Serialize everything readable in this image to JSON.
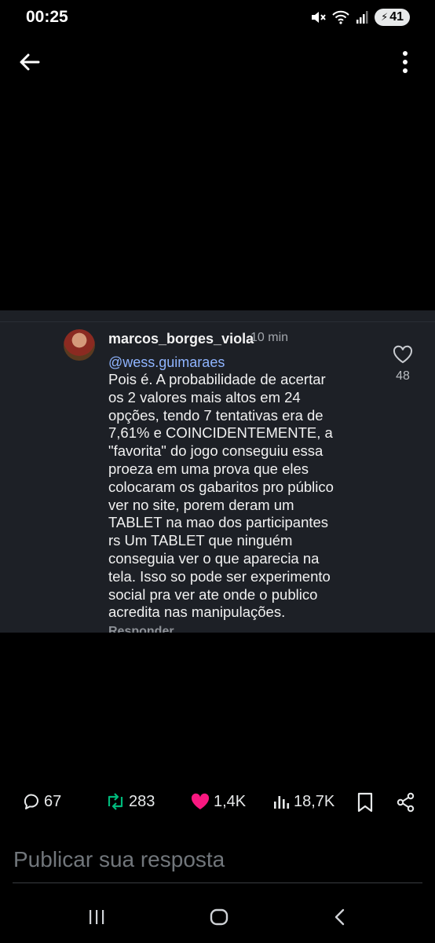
{
  "status_bar": {
    "time": "00:25",
    "battery": "41"
  },
  "comment": {
    "username": "marcos_borges_viola",
    "time_ago": "10 min",
    "mention": "@wess.guimaraes",
    "lines": [
      "Pois é. A probabilidade de acertar",
      "os 2 valores mais altos em 24",
      "opções, tendo 7 tentativas era de",
      "7,61% e COINCIDENTEMENTE, a",
      "\"favorita\" do jogo conseguiu essa",
      "proeza em uma prova que eles",
      "colocaram os gabaritos pro público",
      "ver no site, porem deram um",
      "TABLET na mao dos participantes",
      "rs Um TABLET que ninguém",
      "conseguia ver o que aparecia na",
      "tela. Isso so pode ser experimento",
      "social pra ver ate onde o publico",
      "acredita nas manipulações."
    ],
    "likes": "48",
    "reply_label": "Responder"
  },
  "actions": {
    "replies": "67",
    "reposts": "283",
    "likes": "1,4K",
    "views": "18,7K"
  },
  "colors": {
    "repost": "#00ba7c",
    "like": "#f91880"
  },
  "composer": {
    "placeholder": "Publicar sua resposta"
  }
}
